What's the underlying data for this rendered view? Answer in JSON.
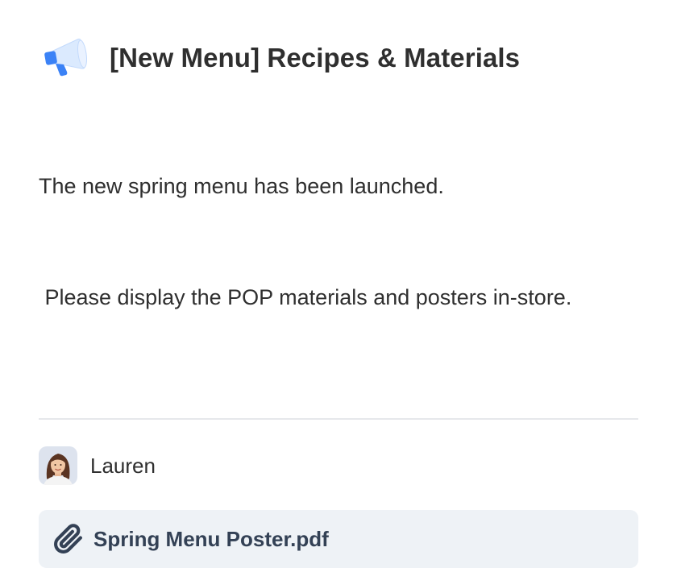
{
  "notice": {
    "icon": "megaphone-icon",
    "title": "[New Menu] Recipes & Materials",
    "body_line_1": "The new spring menu has been launched.",
    "body_line_2": " Please display the POP materials and posters in-store.",
    "author": {
      "name": "Lauren",
      "avatar": "avatar-photo"
    },
    "attachment": {
      "icon": "paperclip-icon",
      "file_name": "Spring Menu Poster.pdf"
    }
  },
  "colors": {
    "text": "#2f2f2f",
    "divider": "#e6e8eb",
    "attachment_bg": "#eef2f6",
    "attachment_text": "#334155",
    "megaphone_blue": "#3b82f6",
    "megaphone_light": "#dbeafe"
  }
}
